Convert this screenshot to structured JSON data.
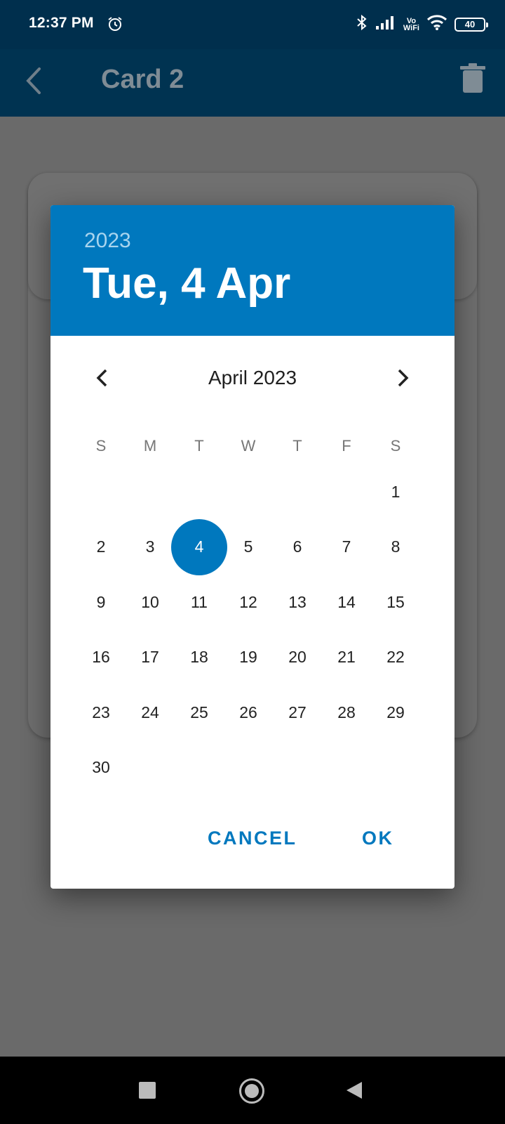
{
  "status_bar": {
    "time": "12:37 PM",
    "vowifi_top": "Vo",
    "vowifi_bottom": "WiFi",
    "battery": "40",
    "icons": [
      "alarm-icon",
      "bluetooth-icon",
      "signal-icon",
      "wifi-icon",
      "battery-icon"
    ]
  },
  "app_bar": {
    "title": "Card 2",
    "icons": [
      "back-arrow-icon",
      "trash-icon"
    ]
  },
  "date_picker": {
    "header_year": "2023",
    "header_date": "Tue, 4 Apr",
    "month_label": "April 2023",
    "weekdays": [
      "S",
      "M",
      "T",
      "W",
      "T",
      "F",
      "S"
    ],
    "weeks": [
      [
        "",
        "",
        "",
        "",
        "",
        "",
        "1"
      ],
      [
        "2",
        "3",
        "4",
        "5",
        "6",
        "7",
        "8"
      ],
      [
        "9",
        "10",
        "11",
        "12",
        "13",
        "14",
        "15"
      ],
      [
        "16",
        "17",
        "18",
        "19",
        "20",
        "21",
        "22"
      ],
      [
        "23",
        "24",
        "25",
        "26",
        "27",
        "28",
        "29"
      ],
      [
        "30",
        "",
        "",
        "",
        "",
        "",
        ""
      ]
    ],
    "selected_day": "4",
    "cancel_label": "CANCEL",
    "ok_label": "OK"
  },
  "nav_bar": {
    "icons": [
      "recents-icon",
      "home-icon",
      "back-icon"
    ]
  },
  "colors": {
    "accent": "#0078be",
    "app_bar": "#003351",
    "scrim_bg": "#6a6a6a"
  }
}
